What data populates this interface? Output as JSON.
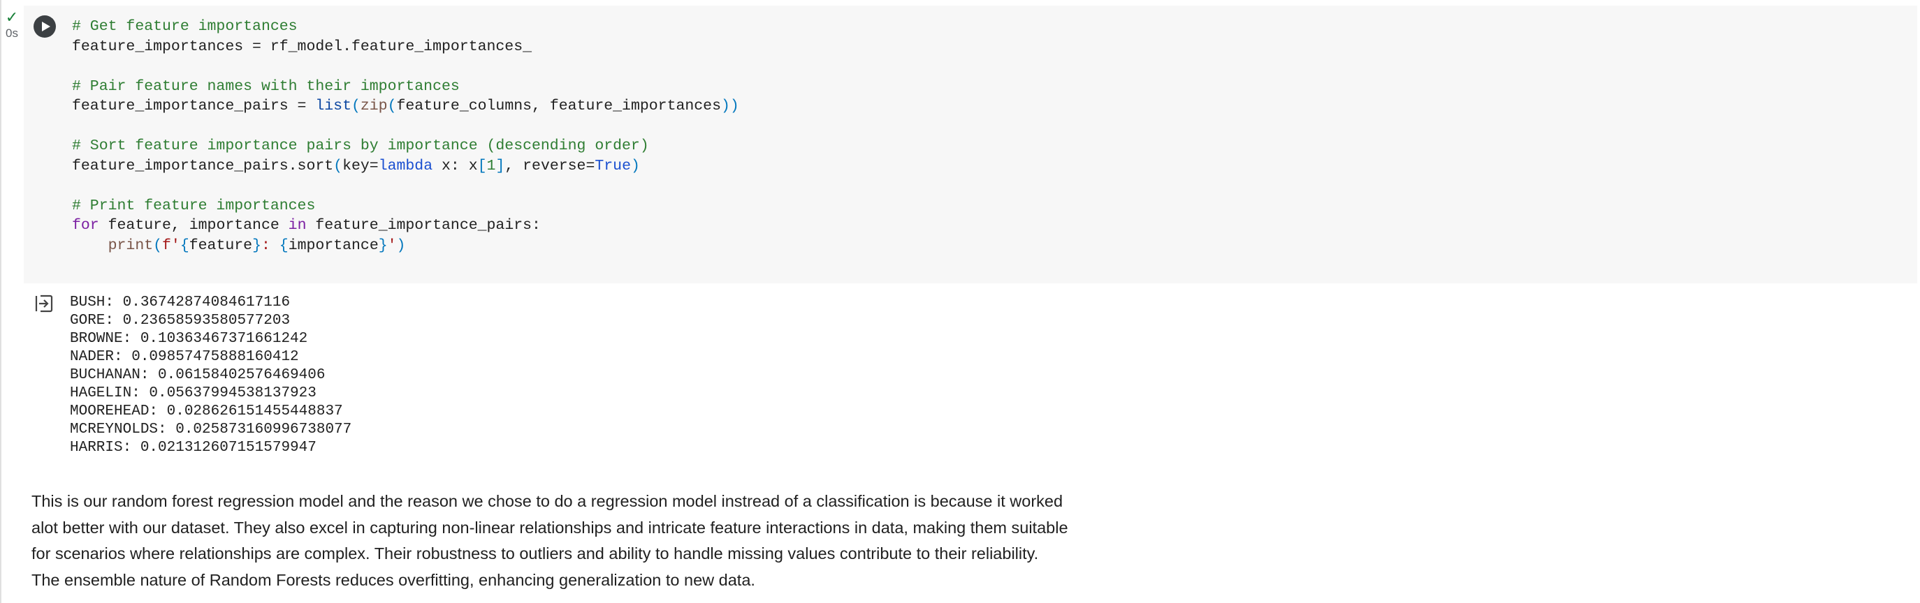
{
  "status": {
    "check": "✓",
    "time": "0s"
  },
  "code_lines": [
    [
      {
        "t": "# Get feature importances",
        "c": "c"
      }
    ],
    [
      {
        "t": "feature_importances = rf_model.feature_importances_",
        "c": ""
      }
    ],
    [],
    [
      {
        "t": "# Pair feature names with their importances",
        "c": "c"
      }
    ],
    [
      {
        "t": "feature_importance_pairs = ",
        "c": ""
      },
      {
        "t": "list",
        "c": "b"
      },
      {
        "t": "(",
        "c": "p"
      },
      {
        "t": "zip",
        "c": "f"
      },
      {
        "t": "(",
        "c": "p"
      },
      {
        "t": "feature_columns, feature_importances",
        "c": ""
      },
      {
        "t": "))",
        "c": "p"
      }
    ],
    [],
    [
      {
        "t": "# Sort feature importance pairs by importance (descending order)",
        "c": "c"
      }
    ],
    [
      {
        "t": "feature_importance_pairs.sort",
        "c": ""
      },
      {
        "t": "(",
        "c": "p"
      },
      {
        "t": "key=",
        "c": ""
      },
      {
        "t": "lambda",
        "c": "v"
      },
      {
        "t": " x: x",
        "c": ""
      },
      {
        "t": "[",
        "c": "p"
      },
      {
        "t": "1",
        "c": "n"
      },
      {
        "t": "]",
        "c": "p"
      },
      {
        "t": ", reverse=",
        "c": ""
      },
      {
        "t": "True",
        "c": "v"
      },
      {
        "t": ")",
        "c": "p"
      }
    ],
    [],
    [
      {
        "t": "# Print feature importances",
        "c": "c"
      }
    ],
    [
      {
        "t": "for",
        "c": "k"
      },
      {
        "t": " feature, importance ",
        "c": ""
      },
      {
        "t": "in",
        "c": "k"
      },
      {
        "t": " feature_importance_pairs:",
        "c": ""
      }
    ],
    [
      {
        "t": "    ",
        "c": ""
      },
      {
        "t": "print",
        "c": "f"
      },
      {
        "t": "(",
        "c": "p"
      },
      {
        "t": "f'",
        "c": "s"
      },
      {
        "t": "{",
        "c": "p"
      },
      {
        "t": "feature",
        "c": ""
      },
      {
        "t": "}",
        "c": "p"
      },
      {
        "t": ": ",
        "c": "s"
      },
      {
        "t": "{",
        "c": "p"
      },
      {
        "t": "importance",
        "c": ""
      },
      {
        "t": "}",
        "c": "p"
      },
      {
        "t": "'",
        "c": "s"
      },
      {
        "t": ")",
        "c": "p"
      }
    ]
  ],
  "output_lines": [
    "BUSH: 0.36742874084617116",
    "GORE: 0.23658593580577203",
    "BROWNE: 0.10363467371661242",
    "NADER: 0.09857475888160412",
    "BUCHANAN: 0.06158402576469406",
    "HAGELIN: 0.05637994538137923",
    "MOOREHEAD: 0.028626151455448837",
    "MCREYNOLDS: 0.025873160996738077",
    "HARRIS: 0.021312607151579947"
  ],
  "text_lines": [
    "This is our random forest regression model and the reason we chose to do a regression model instread of a classification is because it worked",
    "alot better with our dataset. They also excel in capturing non-linear relationships and intricate feature interactions in data, making them suitable",
    "for scenarios where relationships are complex. Their robustness to outliers and ability to handle missing values contribute to their reliability.",
    "The ensemble nature of Random Forests reduces overfitting, enhancing generalization to new data."
  ],
  "icons": {
    "run": "play-icon",
    "output": "output-redirect-icon",
    "status": "check-icon"
  }
}
